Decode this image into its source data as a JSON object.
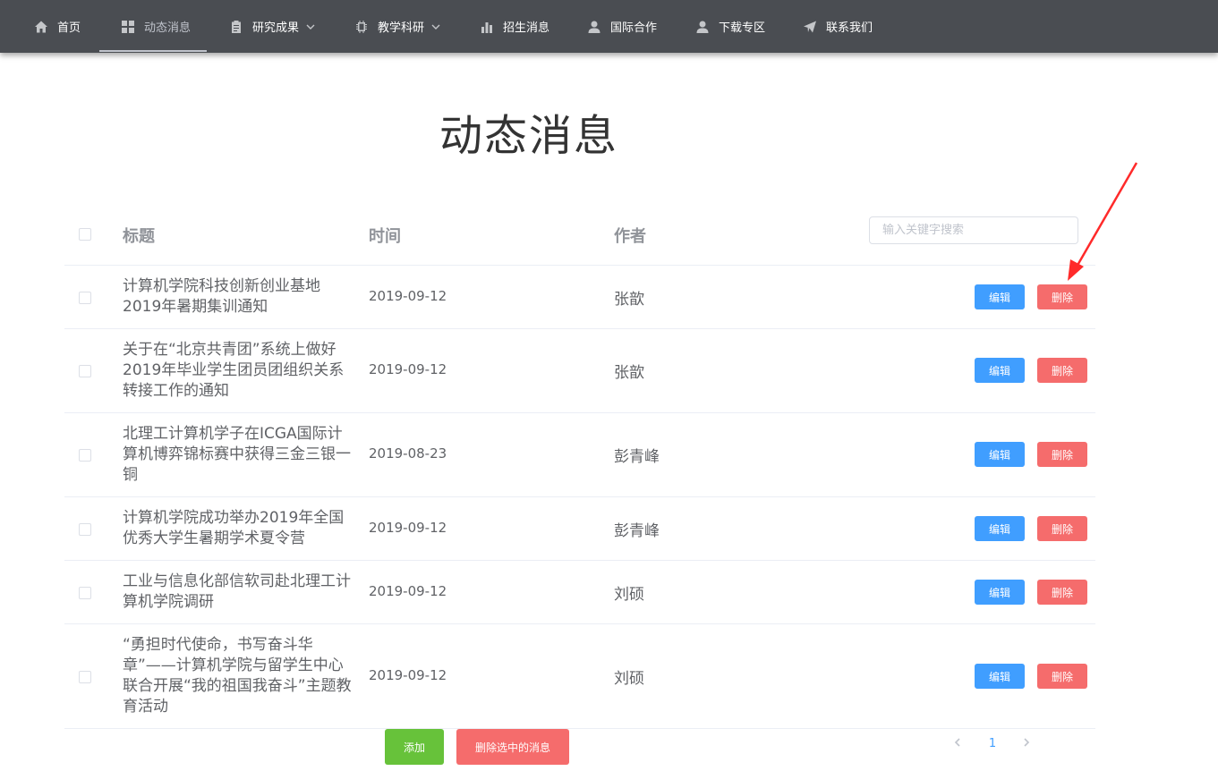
{
  "nav": {
    "items": [
      {
        "label": "首页",
        "icon": "home-icon"
      },
      {
        "label": "动态消息",
        "icon": "grid-icon",
        "active": true
      },
      {
        "label": "研究成果",
        "icon": "clipboard-icon",
        "dropdown": true
      },
      {
        "label": "教学科研",
        "icon": "chip-icon",
        "dropdown": true
      },
      {
        "label": "招生消息",
        "icon": "bar-chart-icon"
      },
      {
        "label": "国际合作",
        "icon": "user-icon"
      },
      {
        "label": "下载专区",
        "icon": "user-icon"
      },
      {
        "label": "联系我们",
        "icon": "send-icon"
      }
    ]
  },
  "page": {
    "title": "动态消息"
  },
  "table": {
    "headers": {
      "title": "标题",
      "time": "时间",
      "author": "作者"
    },
    "search_placeholder": "输入关键字搜索",
    "edit_label": "编辑",
    "delete_label": "删除",
    "rows": [
      {
        "title": "计算机学院科技创新创业基地2019年暑期集训通知",
        "time": "2019-09-12",
        "author": "张歆"
      },
      {
        "title": "关于在“北京共青团”系统上做好2019年毕业学生团员团组织关系转接工作的通知",
        "time": "2019-09-12",
        "author": "张歆"
      },
      {
        "title": "北理工计算机学子在ICGA国际计算机博弈锦标赛中获得三金三银一铜",
        "time": "2019-08-23",
        "author": "彭青峰"
      },
      {
        "title": "计算机学院成功举办2019年全国优秀大学生暑期学术夏令营",
        "time": "2019-09-12",
        "author": "彭青峰"
      },
      {
        "title": "工业与信息化部信软司赴北理工计算机学院调研",
        "time": "2019-09-12",
        "author": "刘硕"
      },
      {
        "title": "“勇担时代使命，书写奋斗华章”——计算机学院与留学生中心联合开展“我的祖国我奋斗”主题教育活动",
        "time": "2019-09-12",
        "author": "刘硕"
      }
    ]
  },
  "footer": {
    "add_label": "添加",
    "delete_selected_label": "删除选中的消息",
    "current_page": "1"
  },
  "colors": {
    "nav_bg": "#4a4d52",
    "primary": "#409eff",
    "danger": "#f56c6c",
    "success": "#67c23a",
    "annotation_arrow": "#ff2a2a"
  }
}
